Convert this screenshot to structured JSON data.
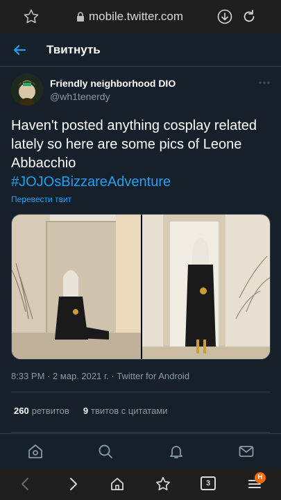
{
  "browser": {
    "url": "mobile.twitter.com",
    "tabs_count": "3",
    "menu_badge": "H"
  },
  "header": {
    "title": "Твитнуть"
  },
  "tweet": {
    "display_name": "Friendly neighborhood DIO",
    "handle": "@wh1tenerdy",
    "text": "Haven't posted anything cosplay related lately so here are some pics of Leone Abbacchio",
    "hashtag": "#JOJOsBizzareAdventure",
    "translate_label": "Перевести твит",
    "timestamp": "8:33 PM · 2 мар. 2021 г. · Twitter for Android",
    "retweets_count": "260",
    "retweets_label": "ретвитов",
    "quotes_count": "9",
    "quotes_label": "твитов с цитатами"
  },
  "colors": {
    "accent": "#1da1f2",
    "background": "#15202b",
    "secondary_text": "#8899a6",
    "fab": "#1a3fa8",
    "badge": "#ff6a00"
  }
}
